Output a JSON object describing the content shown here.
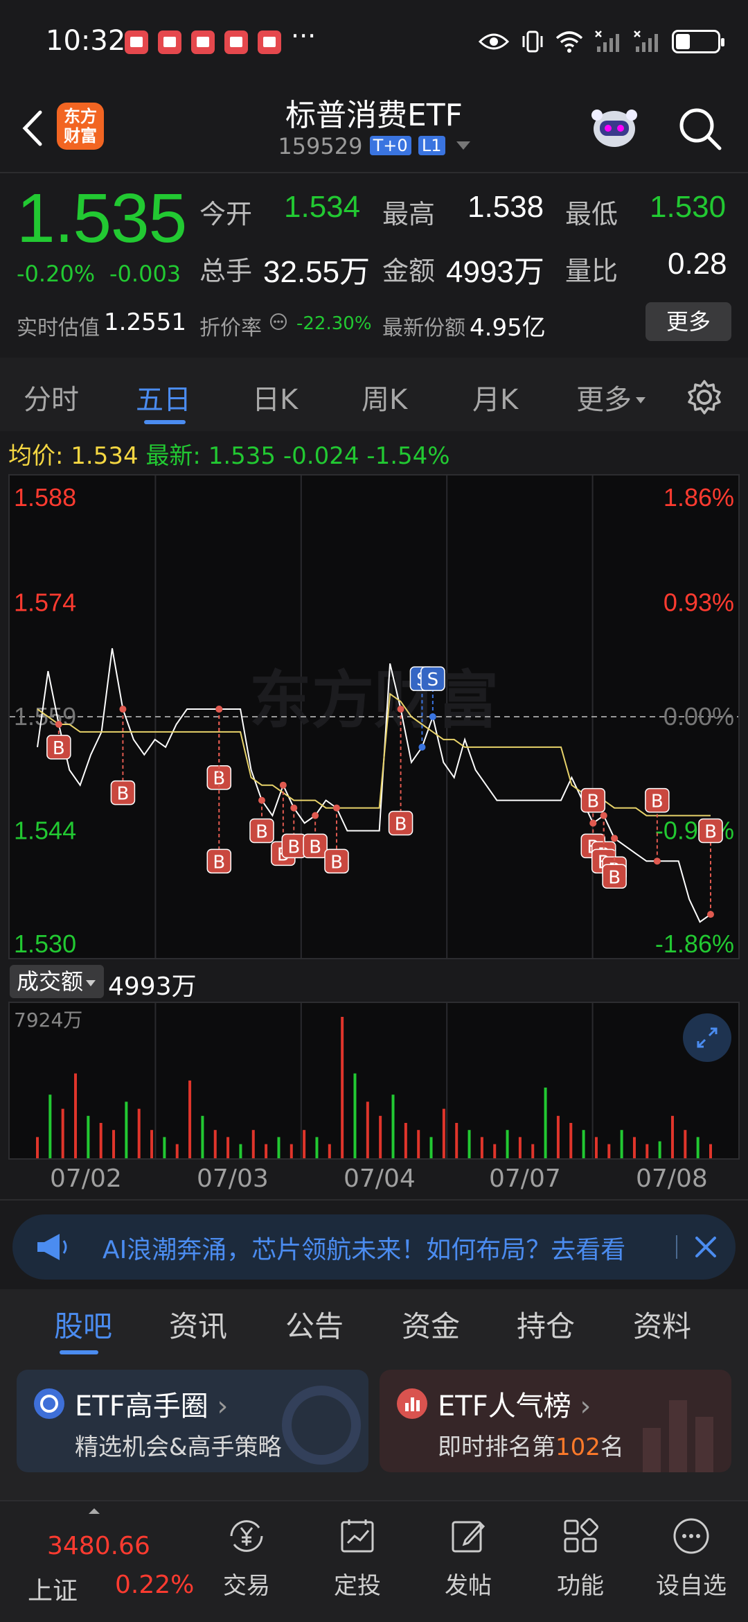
{
  "status_bar": {
    "time": "10:32",
    "more": "···"
  },
  "header": {
    "app_logo_line1": "东方",
    "app_logo_line2": "财富",
    "title": "标普消费ETF",
    "code": "159529",
    "tag1": "T+0",
    "tag2": "L1"
  },
  "quote": {
    "price": "1.535",
    "pct_change": "-0.20%",
    "abs_change": "-0.003",
    "open_label": "今开",
    "open": "1.534",
    "high_label": "最高",
    "high": "1.538",
    "low_label": "最低",
    "low": "1.530",
    "volume_label": "总手",
    "volume": "32.55万",
    "amount_label": "金额",
    "amount": "4993万",
    "ratio_label": "量比",
    "ratio": "0.28",
    "iopv_label": "实时估值",
    "iopv": "1.2551",
    "discount_label": "折价率",
    "discount": "-22.30%",
    "shares_label": "最新份额",
    "shares": "4.95亿",
    "more_button": "更多"
  },
  "chart_tabs": [
    "分时",
    "五日",
    "日K",
    "周K",
    "月K",
    "更多"
  ],
  "chart_info": {
    "avg_label": "均价:",
    "avg": "1.534",
    "latest_label": "最新:",
    "latest": "1.535",
    "chg": "-0.024",
    "chg_pct": "-1.54%"
  },
  "chart_data": {
    "type": "line",
    "title": "",
    "x": [
      "07/02",
      "07/03",
      "07/04",
      "07/07",
      "07/08"
    ],
    "y_left_ticks": [
      "1.588",
      "1.574",
      "1.559",
      "1.544",
      "1.530"
    ],
    "y_right_ticks": [
      "1.86%",
      "0.93%",
      "0.00%",
      "-0.93%",
      "-1.86%"
    ],
    "ylim": [
      1.53,
      1.588
    ],
    "reference_price": 1.559,
    "watermark": "东方财富",
    "series": [
      {
        "values": [
          1.555,
          1.565,
          1.558,
          1.552,
          1.55,
          1.554,
          1.557,
          1.568,
          1.56,
          1.556,
          1.554,
          1.556,
          1.555,
          1.558,
          1.56,
          1.56,
          1.56,
          1.56,
          1.56,
          1.56,
          1.552,
          1.548,
          1.546,
          1.55,
          1.547,
          1.545,
          1.546,
          1.548,
          1.547,
          1.544,
          1.544,
          1.544,
          1.544,
          1.566,
          1.56,
          1.553,
          1.555,
          1.559,
          1.553,
          1.551,
          1.556,
          1.552,
          1.55,
          1.548,
          1.548,
          1.548,
          1.548,
          1.548,
          1.548,
          1.548,
          1.551,
          1.548,
          1.545,
          1.546,
          1.543,
          1.542,
          1.541,
          1.54,
          1.54,
          1.54,
          1.54,
          1.535,
          1.532,
          1.533
        ]
      },
      {
        "values": [
          1.56,
          1.559,
          1.558,
          1.558,
          1.557,
          1.557,
          1.557,
          1.557,
          1.557,
          1.557,
          1.557,
          1.557,
          1.557,
          1.557,
          1.557,
          1.557,
          1.557,
          1.557,
          1.557,
          1.557,
          1.551,
          1.55,
          1.55,
          1.549,
          1.548,
          1.548,
          1.548,
          1.547,
          1.547,
          1.547,
          1.547,
          1.547,
          1.547,
          1.562,
          1.561,
          1.559,
          1.558,
          1.557,
          1.556,
          1.556,
          1.555,
          1.555,
          1.555,
          1.555,
          1.555,
          1.555,
          1.555,
          1.555,
          1.555,
          1.555,
          1.55,
          1.549,
          1.548,
          1.548,
          1.547,
          1.547,
          1.547,
          1.546,
          1.546,
          1.546,
          1.546,
          1.546,
          1.546,
          1.546
        ]
      }
    ],
    "markers": [
      {
        "label": "B",
        "i": 2,
        "y": 1.555
      },
      {
        "label": "B",
        "i": 8,
        "y": 1.549
      },
      {
        "label": "B",
        "i": 17,
        "y": 1.551
      },
      {
        "label": "B",
        "i": 17,
        "y": 1.54
      },
      {
        "label": "B",
        "i": 21,
        "y": 1.544
      },
      {
        "label": "B",
        "i": 23,
        "y": 1.541
      },
      {
        "label": "B",
        "i": 24,
        "y": 1.542
      },
      {
        "label": "B",
        "i": 26,
        "y": 1.542
      },
      {
        "label": "B",
        "i": 28,
        "y": 1.54
      },
      {
        "label": "B",
        "i": 34,
        "y": 1.545
      },
      {
        "label": "S",
        "i": 36,
        "y": 1.564
      },
      {
        "label": "S",
        "i": 37,
        "y": 1.564
      },
      {
        "label": "B",
        "i": 52,
        "y": 1.548
      },
      {
        "label": "B",
        "i": 52,
        "y": 1.542
      },
      {
        "label": "B",
        "i": 53,
        "y": 1.541
      },
      {
        "label": "B",
        "i": 53,
        "y": 1.54
      },
      {
        "label": "B",
        "i": 54,
        "y": 1.539
      },
      {
        "label": "B",
        "i": 54,
        "y": 1.538
      },
      {
        "label": "B",
        "i": 58,
        "y": 1.548
      },
      {
        "label": "B",
        "i": 63,
        "y": 1.544
      }
    ]
  },
  "volume": {
    "selector": "成交额",
    "value": "4993万",
    "max_label": "7924万",
    "ticks": [
      0.15,
      0.45,
      0.35,
      0.6,
      0.3,
      0.25,
      0.2,
      0.4,
      0.35,
      0.2,
      0.15,
      0.1,
      0.55,
      0.3,
      0.2,
      0.15,
      0.1,
      0.2,
      0.1,
      0.15,
      0.1,
      0.2,
      0.15,
      0.1,
      1.0,
      0.6,
      0.4,
      0.3,
      0.45,
      0.25,
      0.2,
      0.15,
      0.35,
      0.25,
      0.2,
      0.15,
      0.1,
      0.2,
      0.15,
      0.1,
      0.5,
      0.3,
      0.25,
      0.2,
      0.15,
      0.1,
      0.2,
      0.15,
      0.1,
      0.12,
      0.3,
      0.2,
      0.15,
      0.1
    ]
  },
  "banner": {
    "text": "AI浪潮奔涌，芯片领航未来！如何布局？去看看"
  },
  "bottom_tabs": [
    "股吧",
    "资讯",
    "公告",
    "资金",
    "持仓",
    "资料"
  ],
  "cards": {
    "left_title": "ETF高手圈",
    "left_sub": "精选机会&高手策略",
    "right_title": "ETF人气榜",
    "right_sub_prefix": "即时排名第",
    "right_rank": "102",
    "right_sub_suffix": "名"
  },
  "bottom_nav": {
    "index_value": "3480.66",
    "index_name": "上证",
    "index_pct": "0.22%",
    "items": [
      "交易",
      "定投",
      "发帖",
      "功能",
      "设自选"
    ]
  }
}
